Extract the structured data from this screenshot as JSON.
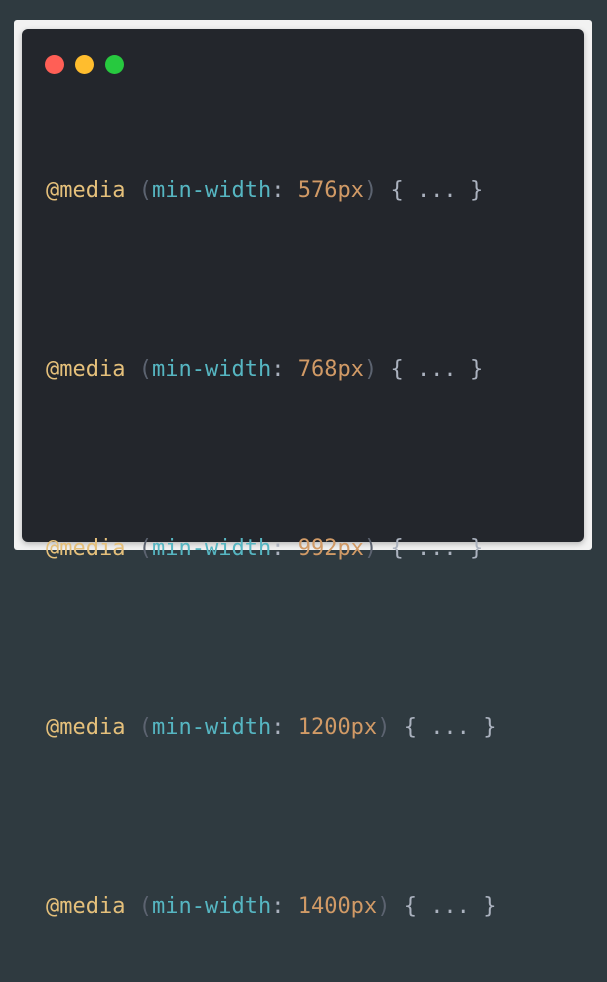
{
  "colors": {
    "background": "#2f3a40",
    "window": "#23262c",
    "red": "#ff5f56",
    "yellow": "#ffbd2e",
    "green": "#27c93f",
    "keyword": "#e5c07b",
    "property": "#56b6c2",
    "number": "#d19a66"
  },
  "window_controls": [
    "close-dot",
    "minimize-dot",
    "maximize-dot"
  ],
  "lines": [
    {
      "at": "@media",
      "open_paren": "(",
      "prop": "min-width",
      "colon": ":",
      "value": "576px",
      "close_paren": ")",
      "brace_open": "{",
      "ellipsis": "...",
      "brace_close": "}"
    },
    {
      "at": "@media",
      "open_paren": "(",
      "prop": "min-width",
      "colon": ":",
      "value": "768px",
      "close_paren": ")",
      "brace_open": "{",
      "ellipsis": "...",
      "brace_close": "}"
    },
    {
      "at": "@media",
      "open_paren": "(",
      "prop": "min-width",
      "colon": ":",
      "value": "992px",
      "close_paren": ")",
      "brace_open": "{",
      "ellipsis": "...",
      "brace_close": "}"
    },
    {
      "at": "@media",
      "open_paren": "(",
      "prop": "min-width",
      "colon": ":",
      "value": "1200px",
      "close_paren": ")",
      "brace_open": "{",
      "ellipsis": "...",
      "brace_close": "}"
    },
    {
      "at": "@media",
      "open_paren": "(",
      "prop": "min-width",
      "colon": ":",
      "value": "1400px",
      "close_paren": ")",
      "brace_open": "{",
      "ellipsis": "...",
      "brace_close": "}"
    }
  ]
}
